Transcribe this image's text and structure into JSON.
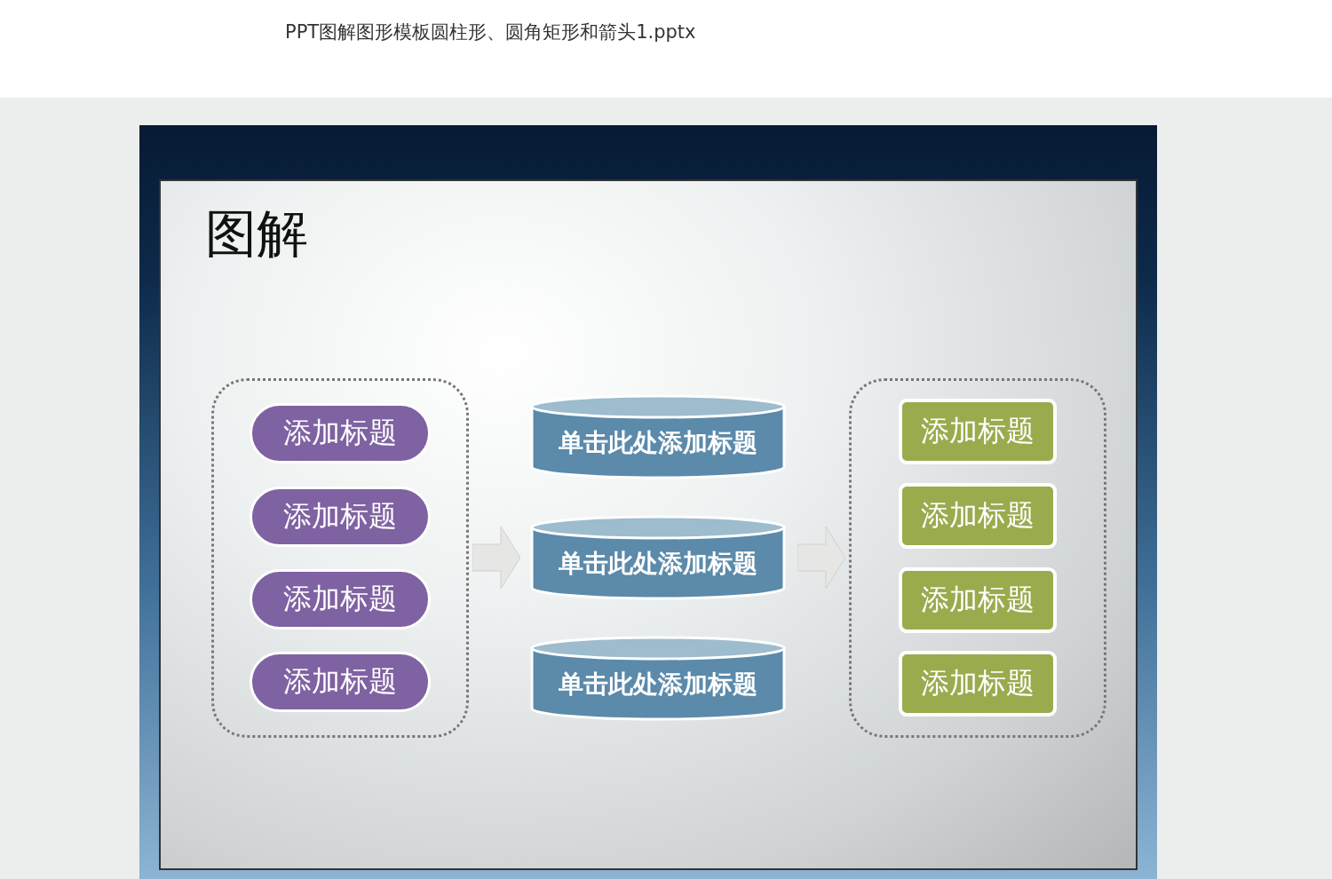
{
  "page": {
    "title": "PPT图解图形模板圆柱形、圆角矩形和箭头1.pptx"
  },
  "slide": {
    "title": "图解",
    "left_items": [
      "添加标题",
      "添加标题",
      "添加标题",
      "添加标题"
    ],
    "cylinders": [
      "单击此处添加标题",
      "单击此处添加标题",
      "单击此处添加标题"
    ],
    "right_items": [
      "添加标题",
      "添加标题",
      "添加标题",
      "添加标题"
    ]
  }
}
